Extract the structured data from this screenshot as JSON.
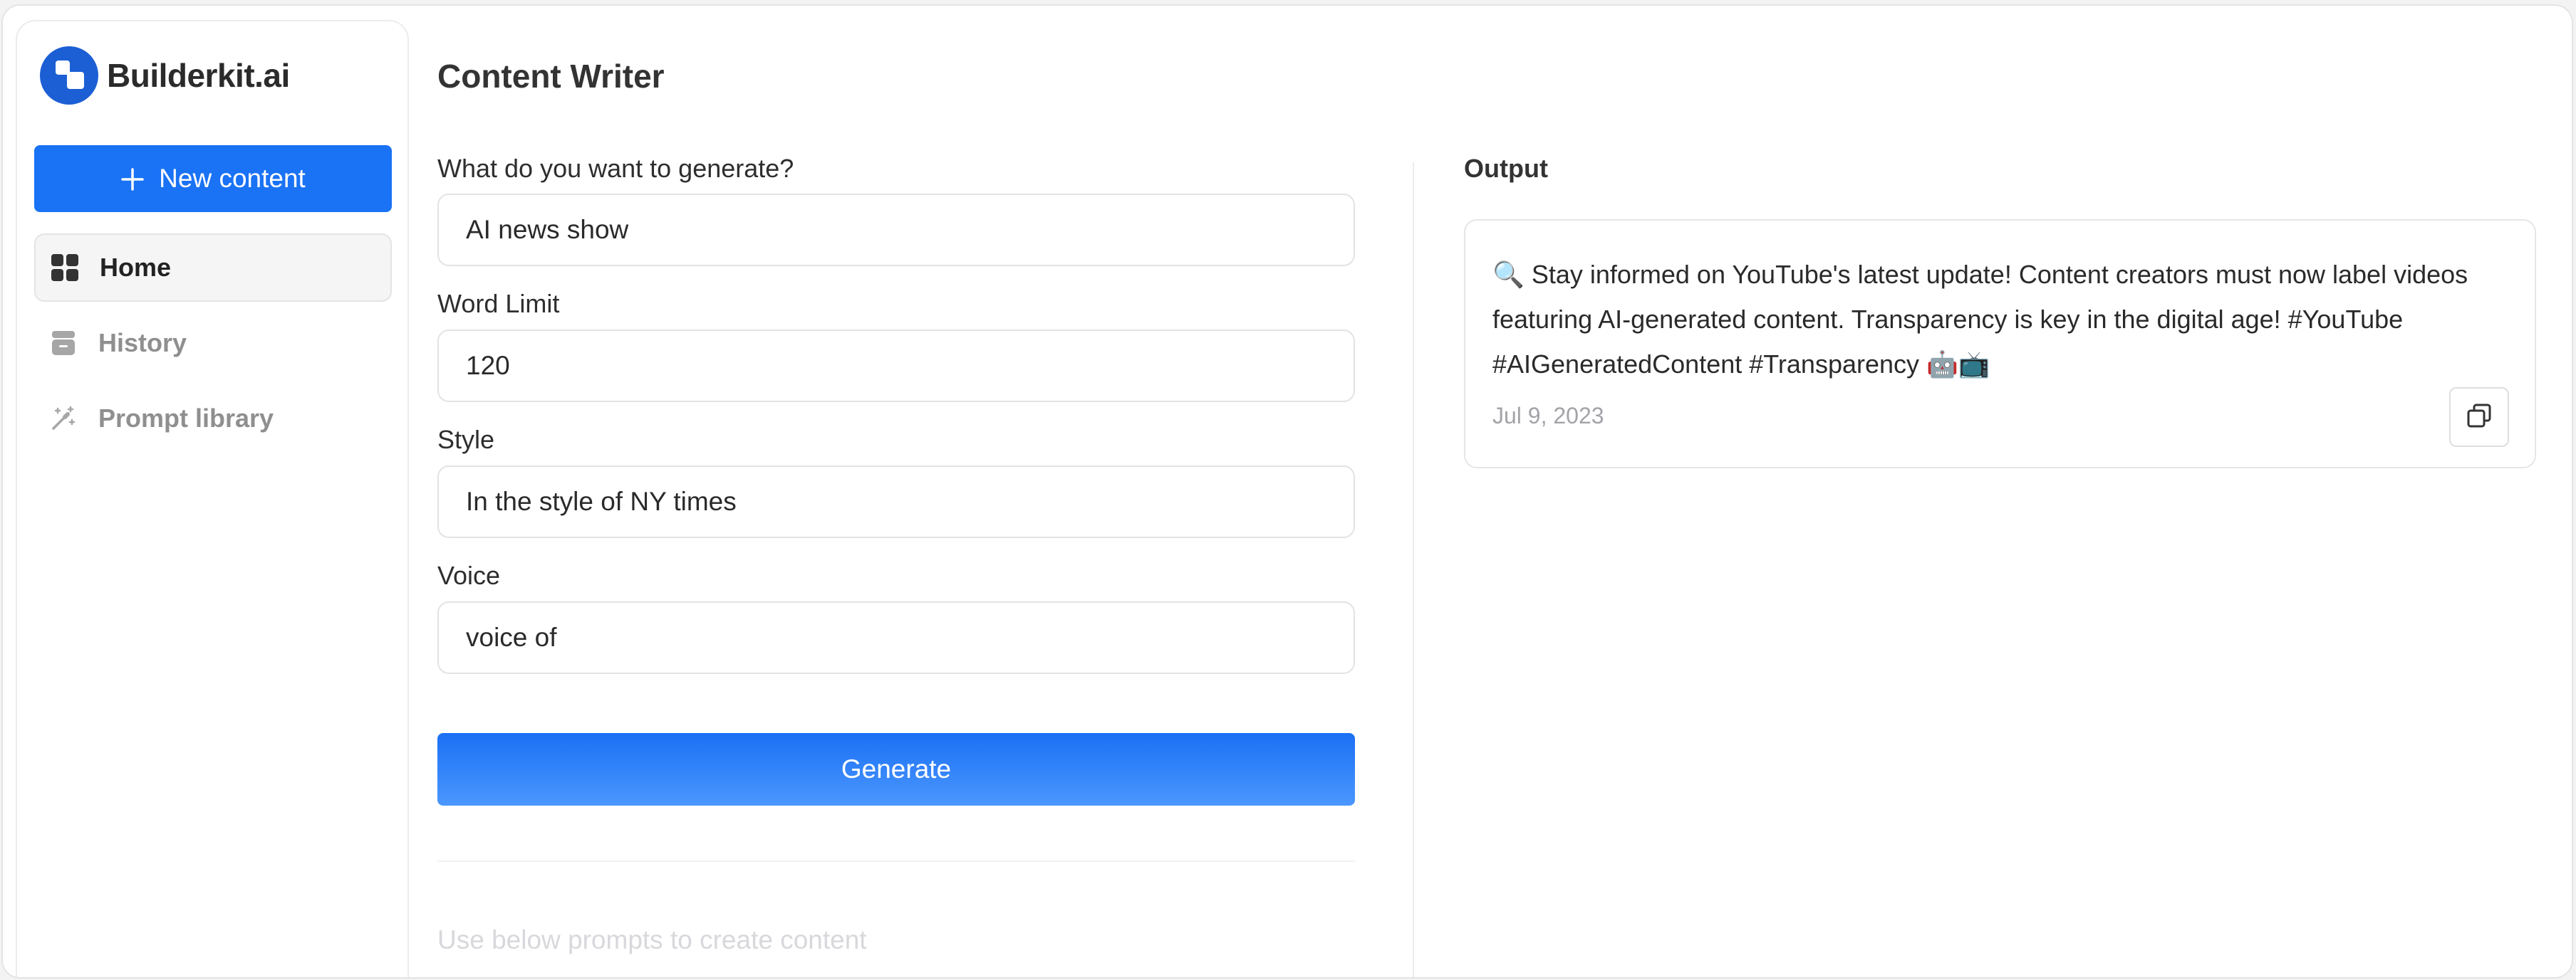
{
  "brand": {
    "name": "Builderkit.ai",
    "accent": "#1c5fd4"
  },
  "sidebar": {
    "new_button": {
      "label": "New content",
      "icon": "plus-icon",
      "color": "#1a72f5"
    },
    "items": [
      {
        "label": "Home",
        "icon": "grid-icon",
        "active": true
      },
      {
        "label": "History",
        "icon": "archive-icon",
        "active": false
      },
      {
        "label": "Prompt library",
        "icon": "magic-wand-icon",
        "active": false
      }
    ]
  },
  "main": {
    "title": "Content Writer",
    "fields": [
      {
        "label": "What do you want to generate?",
        "value": "AI news show"
      },
      {
        "label": "Word Limit",
        "value": "120"
      },
      {
        "label": "Style",
        "value": "In the style of NY times"
      },
      {
        "label": "Voice",
        "value": "voice of"
      }
    ],
    "generate_button": "Generate",
    "prompts_hint": "Use below prompts to create content"
  },
  "output": {
    "label": "Output",
    "cards": [
      {
        "text": "🔍 Stay informed on YouTube's latest update! Content creators must now label videos featuring AI-generated content. Transparency is key in the digital age! #YouTube #AIGeneratedContent #Transparency 🤖📺",
        "date": "Jul 9, 2023",
        "copy_icon": "copy-icon"
      }
    ]
  }
}
